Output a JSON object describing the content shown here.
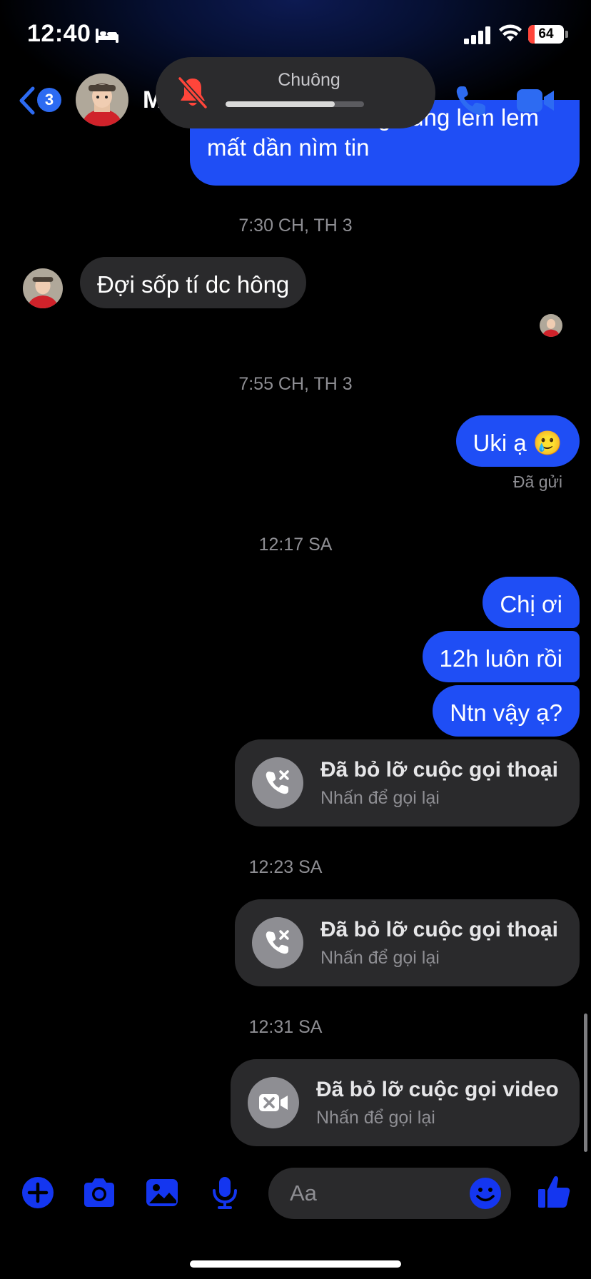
{
  "status_bar": {
    "time": "12:40",
    "battery_percent": "64",
    "icons": [
      "bed-icon",
      "cellular-signal-icon",
      "wifi-icon",
      "battery-icon"
    ]
  },
  "header": {
    "back_badge_count": "3",
    "contact_name": "M",
    "accent_color": "#2d6bf2",
    "icons": [
      "chevron-left-icon",
      "phone-icon",
      "video-camera-icon"
    ]
  },
  "ringer_overlay": {
    "label": "Chuông",
    "level": 0.79,
    "icon": "bell-slash-icon",
    "icon_color": "#ff453a"
  },
  "messages": {
    "top_partial_bubble": {
      "line1": "😢 vs ơi lem tieng dung lem lem",
      "line2": "mất dần nìm tin"
    },
    "ts1": "7:30 CH, TH 3",
    "incoming_1": "Đợi sốp tí dc hông",
    "ts2": "7:55 CH, TH 3",
    "outgoing_1": "Uki ạ 🥲",
    "sent_status": "Đã gửi",
    "ts3": "12:17 SA",
    "outgoing_2": "Chị ơi",
    "outgoing_3": "12h luôn rồi",
    "outgoing_4": "Ntn vậy ạ?",
    "ts4": "12:23 SA",
    "ts5": "12:31 SA",
    "outgoing_bubble_color": "#1f4ef5"
  },
  "missed_calls": [
    {
      "title": "Đã bỏ lỡ cuộc gọi thoại",
      "subtitle": "Nhấn để gọi lại",
      "icon": "missed-voice-call-icon"
    },
    {
      "title": "Đã bỏ lỡ cuộc gọi thoại",
      "subtitle": "Nhấn để gọi lại",
      "icon": "missed-voice-call-icon"
    },
    {
      "title": "Đã bỏ lỡ cuộc gọi video",
      "subtitle": "Nhấn để gọi lại",
      "icon": "missed-video-call-icon"
    }
  ],
  "composer": {
    "placeholder": "Aa",
    "accent_color": "#1436f0",
    "icons": [
      "plus-circle-icon",
      "camera-icon",
      "photo-icon",
      "microphone-icon",
      "emoji-icon",
      "thumbs-up-icon"
    ]
  }
}
